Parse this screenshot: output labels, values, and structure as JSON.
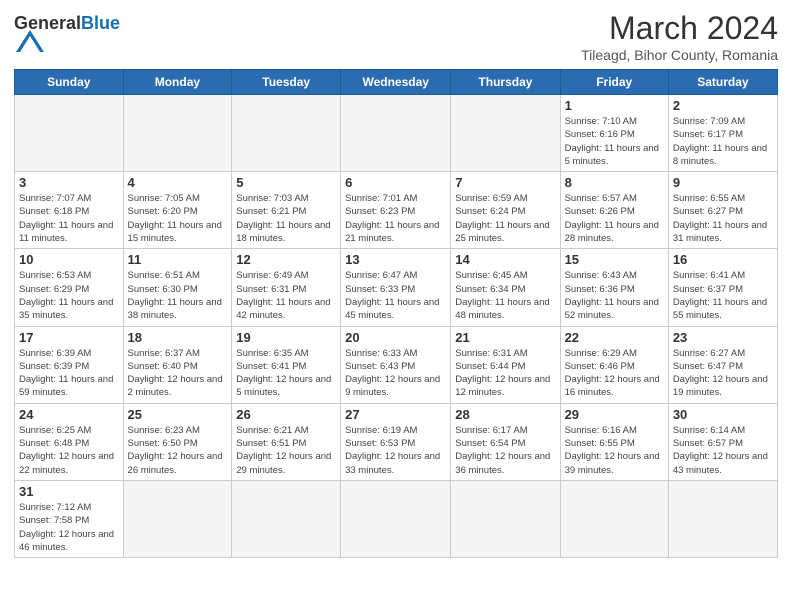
{
  "header": {
    "logo_general": "General",
    "logo_blue": "Blue",
    "month_title": "March 2024",
    "location": "Tileagd, Bihor County, Romania"
  },
  "weekdays": [
    "Sunday",
    "Monday",
    "Tuesday",
    "Wednesday",
    "Thursday",
    "Friday",
    "Saturday"
  ],
  "weeks": [
    [
      {
        "day": "",
        "info": ""
      },
      {
        "day": "",
        "info": ""
      },
      {
        "day": "",
        "info": ""
      },
      {
        "day": "",
        "info": ""
      },
      {
        "day": "",
        "info": ""
      },
      {
        "day": "1",
        "info": "Sunrise: 7:10 AM\nSunset: 6:16 PM\nDaylight: 11 hours and 5 minutes."
      },
      {
        "day": "2",
        "info": "Sunrise: 7:09 AM\nSunset: 6:17 PM\nDaylight: 11 hours and 8 minutes."
      }
    ],
    [
      {
        "day": "3",
        "info": "Sunrise: 7:07 AM\nSunset: 6:18 PM\nDaylight: 11 hours and 11 minutes."
      },
      {
        "day": "4",
        "info": "Sunrise: 7:05 AM\nSunset: 6:20 PM\nDaylight: 11 hours and 15 minutes."
      },
      {
        "day": "5",
        "info": "Sunrise: 7:03 AM\nSunset: 6:21 PM\nDaylight: 11 hours and 18 minutes."
      },
      {
        "day": "6",
        "info": "Sunrise: 7:01 AM\nSunset: 6:23 PM\nDaylight: 11 hours and 21 minutes."
      },
      {
        "day": "7",
        "info": "Sunrise: 6:59 AM\nSunset: 6:24 PM\nDaylight: 11 hours and 25 minutes."
      },
      {
        "day": "8",
        "info": "Sunrise: 6:57 AM\nSunset: 6:26 PM\nDaylight: 11 hours and 28 minutes."
      },
      {
        "day": "9",
        "info": "Sunrise: 6:55 AM\nSunset: 6:27 PM\nDaylight: 11 hours and 31 minutes."
      }
    ],
    [
      {
        "day": "10",
        "info": "Sunrise: 6:53 AM\nSunset: 6:29 PM\nDaylight: 11 hours and 35 minutes."
      },
      {
        "day": "11",
        "info": "Sunrise: 6:51 AM\nSunset: 6:30 PM\nDaylight: 11 hours and 38 minutes."
      },
      {
        "day": "12",
        "info": "Sunrise: 6:49 AM\nSunset: 6:31 PM\nDaylight: 11 hours and 42 minutes."
      },
      {
        "day": "13",
        "info": "Sunrise: 6:47 AM\nSunset: 6:33 PM\nDaylight: 11 hours and 45 minutes."
      },
      {
        "day": "14",
        "info": "Sunrise: 6:45 AM\nSunset: 6:34 PM\nDaylight: 11 hours and 48 minutes."
      },
      {
        "day": "15",
        "info": "Sunrise: 6:43 AM\nSunset: 6:36 PM\nDaylight: 11 hours and 52 minutes."
      },
      {
        "day": "16",
        "info": "Sunrise: 6:41 AM\nSunset: 6:37 PM\nDaylight: 11 hours and 55 minutes."
      }
    ],
    [
      {
        "day": "17",
        "info": "Sunrise: 6:39 AM\nSunset: 6:39 PM\nDaylight: 11 hours and 59 minutes."
      },
      {
        "day": "18",
        "info": "Sunrise: 6:37 AM\nSunset: 6:40 PM\nDaylight: 12 hours and 2 minutes."
      },
      {
        "day": "19",
        "info": "Sunrise: 6:35 AM\nSunset: 6:41 PM\nDaylight: 12 hours and 5 minutes."
      },
      {
        "day": "20",
        "info": "Sunrise: 6:33 AM\nSunset: 6:43 PM\nDaylight: 12 hours and 9 minutes."
      },
      {
        "day": "21",
        "info": "Sunrise: 6:31 AM\nSunset: 6:44 PM\nDaylight: 12 hours and 12 minutes."
      },
      {
        "day": "22",
        "info": "Sunrise: 6:29 AM\nSunset: 6:46 PM\nDaylight: 12 hours and 16 minutes."
      },
      {
        "day": "23",
        "info": "Sunrise: 6:27 AM\nSunset: 6:47 PM\nDaylight: 12 hours and 19 minutes."
      }
    ],
    [
      {
        "day": "24",
        "info": "Sunrise: 6:25 AM\nSunset: 6:48 PM\nDaylight: 12 hours and 22 minutes."
      },
      {
        "day": "25",
        "info": "Sunrise: 6:23 AM\nSunset: 6:50 PM\nDaylight: 12 hours and 26 minutes."
      },
      {
        "day": "26",
        "info": "Sunrise: 6:21 AM\nSunset: 6:51 PM\nDaylight: 12 hours and 29 minutes."
      },
      {
        "day": "27",
        "info": "Sunrise: 6:19 AM\nSunset: 6:53 PM\nDaylight: 12 hours and 33 minutes."
      },
      {
        "day": "28",
        "info": "Sunrise: 6:17 AM\nSunset: 6:54 PM\nDaylight: 12 hours and 36 minutes."
      },
      {
        "day": "29",
        "info": "Sunrise: 6:16 AM\nSunset: 6:55 PM\nDaylight: 12 hours and 39 minutes."
      },
      {
        "day": "30",
        "info": "Sunrise: 6:14 AM\nSunset: 6:57 PM\nDaylight: 12 hours and 43 minutes."
      }
    ],
    [
      {
        "day": "31",
        "info": "Sunrise: 7:12 AM\nSunset: 7:58 PM\nDaylight: 12 hours and 46 minutes."
      },
      {
        "day": "",
        "info": ""
      },
      {
        "day": "",
        "info": ""
      },
      {
        "day": "",
        "info": ""
      },
      {
        "day": "",
        "info": ""
      },
      {
        "day": "",
        "info": ""
      },
      {
        "day": "",
        "info": ""
      }
    ]
  ]
}
